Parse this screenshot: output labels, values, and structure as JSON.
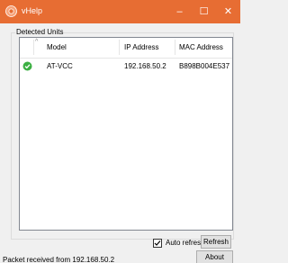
{
  "window": {
    "title": "vHelp",
    "icon": "orange-app-icon",
    "controls": {
      "minimize": "–",
      "maximize": "☐",
      "close": "✕"
    },
    "accent_color": "#e76d33"
  },
  "group": {
    "label": "Detected Units"
  },
  "list": {
    "columns": [
      "Model",
      "IP Address",
      "MAC Address"
    ],
    "sort_indicator": "^",
    "rows": [
      {
        "status_icon": "green-check-icon",
        "model": "AT-VCC",
        "ip": "192.168.50.2",
        "mac": "B898B004E537"
      }
    ]
  },
  "controls": {
    "auto_refresh_label": "Auto refresh",
    "auto_refresh_checked": true,
    "refresh_label": "Refresh",
    "about_label": "About"
  },
  "status": {
    "text": "Packet received from 192.168.50.2"
  }
}
